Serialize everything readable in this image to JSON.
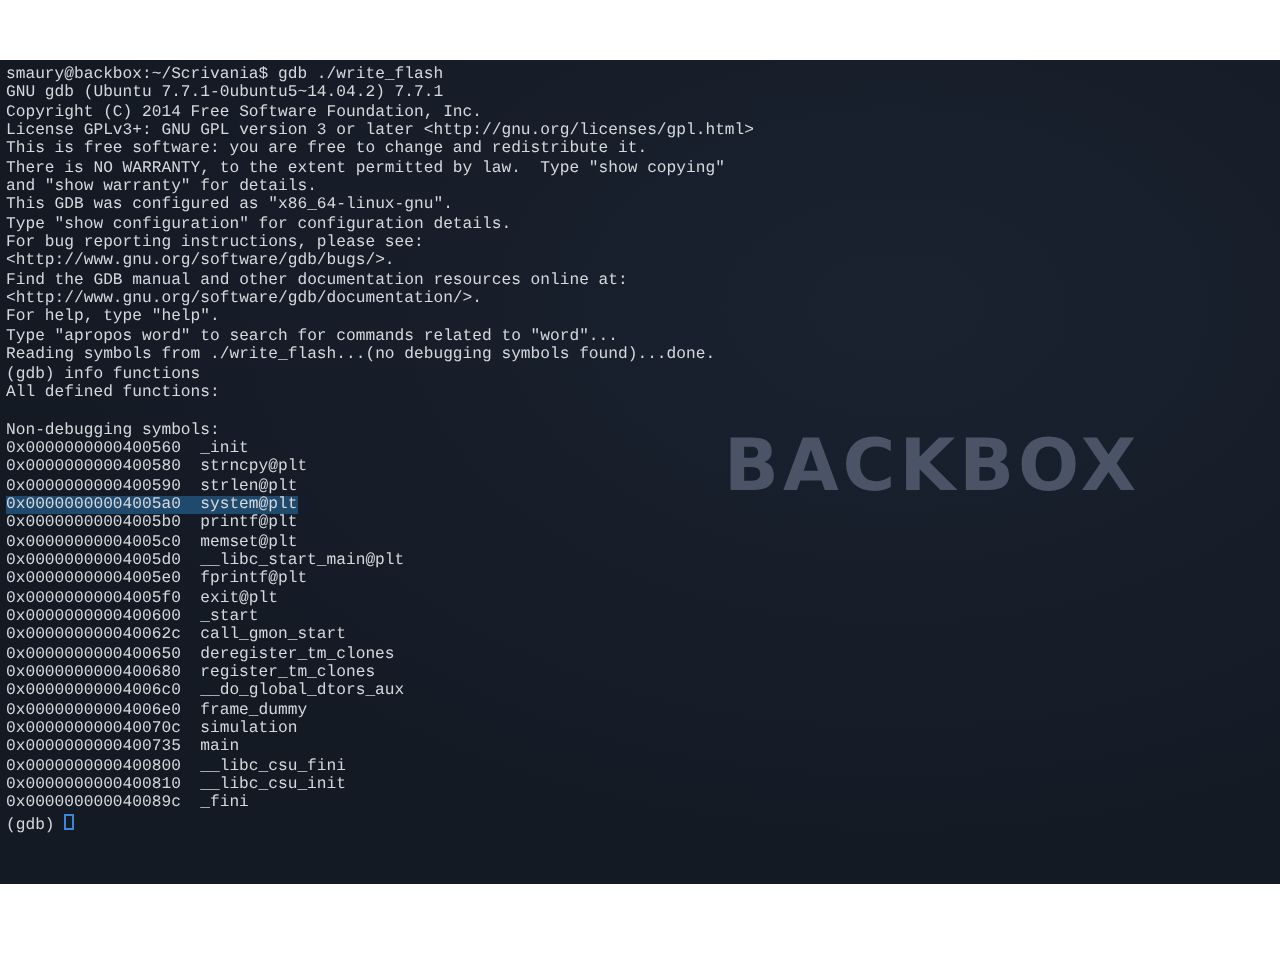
{
  "wallpaper": {
    "logo": "BACKBOX"
  },
  "terminal": {
    "output_lines": [
      "smaury@backbox:~/Scrivania$ gdb ./write_flash",
      "GNU gdb (Ubuntu 7.7.1-0ubuntu5~14.04.2) 7.7.1",
      "Copyright (C) 2014 Free Software Foundation, Inc.",
      "License GPLv3+: GNU GPL version 3 or later <http://gnu.org/licenses/gpl.html>",
      "This is free software: you are free to change and redistribute it.",
      "There is NO WARRANTY, to the extent permitted by law.  Type \"show copying\"",
      "and \"show warranty\" for details.",
      "This GDB was configured as \"x86_64-linux-gnu\".",
      "Type \"show configuration\" for configuration details.",
      "For bug reporting instructions, please see:",
      "<http://www.gnu.org/software/gdb/bugs/>.",
      "Find the GDB manual and other documentation resources online at:",
      "<http://www.gnu.org/software/gdb/documentation/>.",
      "For help, type \"help\".",
      "Type \"apropos word\" to search for commands related to \"word\"...",
      "Reading symbols from ./write_flash...(no debugging symbols found)...done.",
      "(gdb) info functions",
      "All defined functions:"
    ],
    "symbols_heading": "Non-debugging symbols:",
    "symbols": [
      {
        "address": "0x0000000000400560",
        "name": "_init",
        "selected": false
      },
      {
        "address": "0x0000000000400580",
        "name": "strncpy@plt",
        "selected": false
      },
      {
        "address": "0x0000000000400590",
        "name": "strlen@plt",
        "selected": false
      },
      {
        "address": "0x00000000004005a0",
        "name": "system@plt",
        "selected": true
      },
      {
        "address": "0x00000000004005b0",
        "name": "printf@plt",
        "selected": false
      },
      {
        "address": "0x00000000004005c0",
        "name": "memset@plt",
        "selected": false
      },
      {
        "address": "0x00000000004005d0",
        "name": "__libc_start_main@plt",
        "selected": false
      },
      {
        "address": "0x00000000004005e0",
        "name": "fprintf@plt",
        "selected": false
      },
      {
        "address": "0x00000000004005f0",
        "name": "exit@plt",
        "selected": false
      },
      {
        "address": "0x0000000000400600",
        "name": "_start",
        "selected": false
      },
      {
        "address": "0x000000000040062c",
        "name": "call_gmon_start",
        "selected": false
      },
      {
        "address": "0x0000000000400650",
        "name": "deregister_tm_clones",
        "selected": false
      },
      {
        "address": "0x0000000000400680",
        "name": "register_tm_clones",
        "selected": false
      },
      {
        "address": "0x00000000004006c0",
        "name": "__do_global_dtors_aux",
        "selected": false
      },
      {
        "address": "0x00000000004006e0",
        "name": "frame_dummy",
        "selected": false
      },
      {
        "address": "0x000000000040070c",
        "name": "simulation",
        "selected": false
      },
      {
        "address": "0x0000000000400735",
        "name": "main",
        "selected": false
      },
      {
        "address": "0x0000000000400800",
        "name": "__libc_csu_fini",
        "selected": false
      },
      {
        "address": "0x0000000000400810",
        "name": "__libc_csu_init",
        "selected": false
      },
      {
        "address": "0x000000000040089c",
        "name": "_fini",
        "selected": false
      }
    ],
    "prompt": "(gdb)",
    "cursor_visible": true
  }
}
